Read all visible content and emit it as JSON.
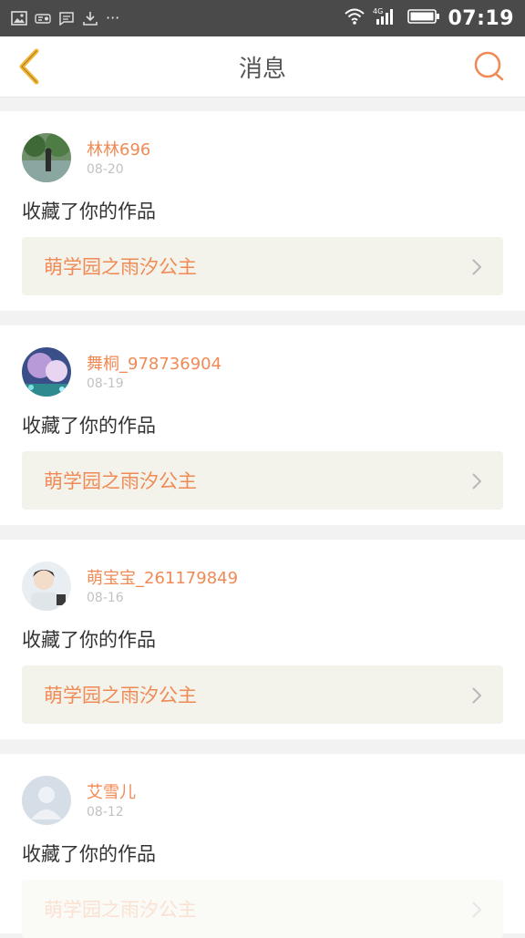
{
  "status_bar": {
    "time": "07:19",
    "dots": "···",
    "network": "4G"
  },
  "header": {
    "title": "消息"
  },
  "colors": {
    "accent": "#f08a55",
    "back_arrow": "#f2b533",
    "card_bg": "#ffffff",
    "page_bg": "#f2f2f2",
    "work_bg": "#f3f3ec"
  },
  "messages": [
    {
      "user": "林林696",
      "date": "08-20",
      "action": "收藏了你的作品",
      "work": "萌学园之雨汐公主",
      "avatar": "photo-avatar-nature"
    },
    {
      "user": "舞桐_978736904",
      "date": "08-19",
      "action": "收藏了你的作品",
      "work": "萌学园之雨汐公主",
      "avatar": "photo-avatar-anime"
    },
    {
      "user": "萌宝宝_261179849",
      "date": "08-16",
      "action": "收藏了你的作品",
      "work": "萌学园之雨汐公主",
      "avatar": "photo-avatar-person"
    },
    {
      "user": "艾雪儿",
      "date": "08-12",
      "action": "收藏了你的作品",
      "work": "萌学园之雨汐公主",
      "avatar": "default-avatar"
    }
  ]
}
